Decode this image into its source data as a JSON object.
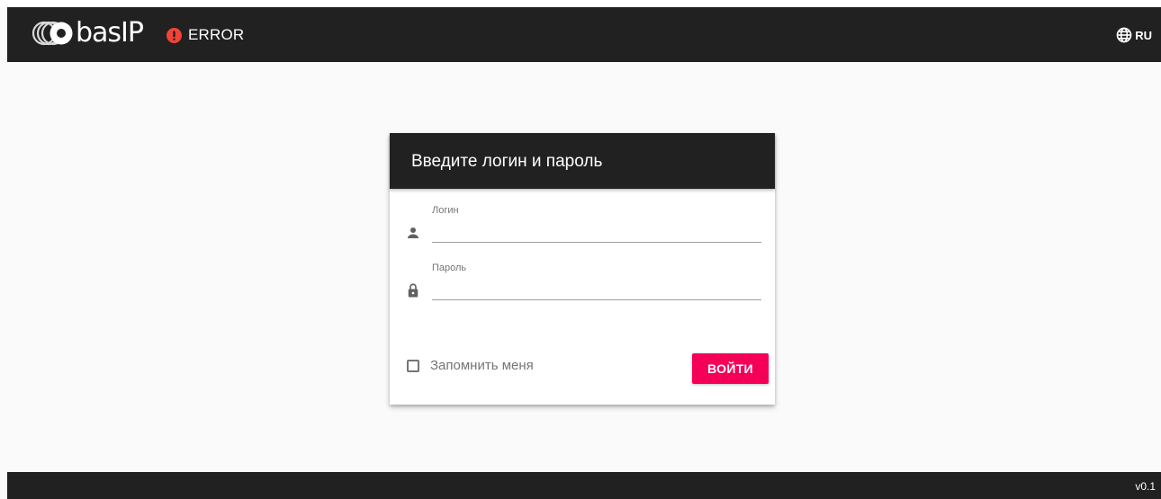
{
  "header": {
    "logo_text": "basIP",
    "status_text": "ERROR",
    "language": "RU",
    "colors": {
      "background": "#212121",
      "error": "#f44336"
    }
  },
  "login_card": {
    "title": "Введите логин и пароль",
    "login_field": {
      "label": "Логин",
      "value": "",
      "icon": "person-icon"
    },
    "password_field": {
      "label": "Пароль",
      "value": "",
      "icon": "lock-icon"
    },
    "remember_label": "Запомнить меня",
    "remember_checked": false,
    "submit_label": "ВОЙТИ",
    "colors": {
      "accent": "#f50057",
      "header": "#212121"
    }
  },
  "footer": {
    "version": "v0.1"
  }
}
